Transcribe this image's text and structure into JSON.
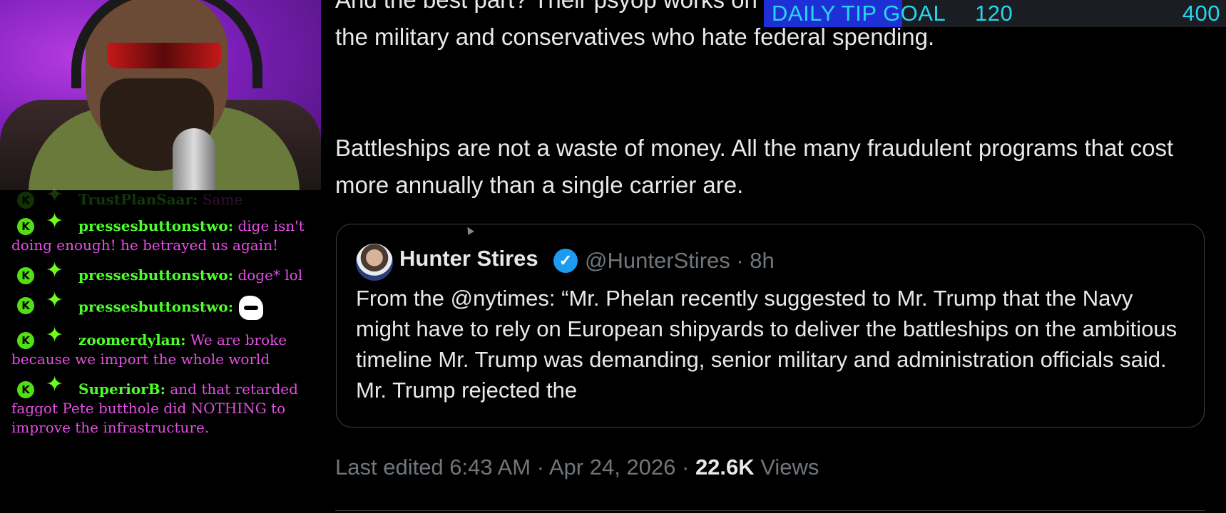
{
  "tweet": {
    "paragraph1": "And the best part? Their psyop works on both sides. It appeals to liberals who hate the military and conservatives who hate federal spending.",
    "paragraph2": "Battleships are not a waste of money. All the many fraudulent programs that cost more annually than a single carrier are."
  },
  "quote": {
    "name": "Hunter Stires",
    "handle": "@HunterStires · 8h",
    "body": "From the @nytimes: “Mr. Phelan recently suggested to Mr. Trump that the Navy might have to rely on European shipyards to deliver the battleships on the ambitious timeline Mr. Trump was demanding, senior military and administration officials said. Mr. Trump rejected the"
  },
  "meta": {
    "edited": "Last edited 6:43 AM · Apr 24, 2026 · ",
    "views_count": "22.6K",
    "views_label": " Views"
  },
  "tip_goal": {
    "label": "DAILY TIP GOAL",
    "current": "120",
    "goal": "400",
    "progress": 0.3
  },
  "chat": {
    "badge_letter": "K",
    "messages": [
      {
        "user": "TrustPlanSaar:",
        "text": "Same"
      },
      {
        "user": "pressesbuttonstwo:",
        "text": "dige isn't doing enough! he betrayed us again!"
      },
      {
        "user": "pressesbuttonstwo:",
        "text": "doge* lol"
      },
      {
        "user": "pressesbuttonstwo:",
        "text": ""
      },
      {
        "user": "zoomerdylan:",
        "text": "We are broke because we import the whole world"
      },
      {
        "user": "SuperiorB:",
        "text": "and that retarded faggot Pete butthole did NOTHING to improve the infrastructure."
      }
    ]
  },
  "colors": {
    "username": "#4dff2a",
    "message_text": "#e34fe3",
    "tip_text": "#27d7f0",
    "tip_fill": "#1e2fd6",
    "verified": "#1d9bf0"
  }
}
